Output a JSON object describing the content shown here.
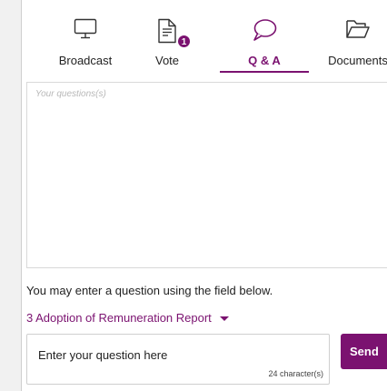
{
  "tabs": [
    {
      "label": "Broadcast",
      "icon": "monitor-icon",
      "active": false
    },
    {
      "label": "Vote",
      "icon": "document-icon",
      "active": false,
      "badge": "1"
    },
    {
      "label": "Q & A",
      "icon": "chat-bubble-icon",
      "active": true
    },
    {
      "label": "Documents",
      "icon": "folder-icon",
      "active": false
    }
  ],
  "questions": {
    "placeholder": "Your questions(s)"
  },
  "hint": "You may enter a question using the field below.",
  "agenda_item": "3 Adoption of Remuneration Report",
  "question_input": {
    "placeholder": "Enter your question here",
    "char_count": "24 character(s)"
  },
  "send_label": "Send",
  "colors": {
    "accent": "#7b1270",
    "background": "#f1f1f1",
    "panel": "#ffffff"
  }
}
